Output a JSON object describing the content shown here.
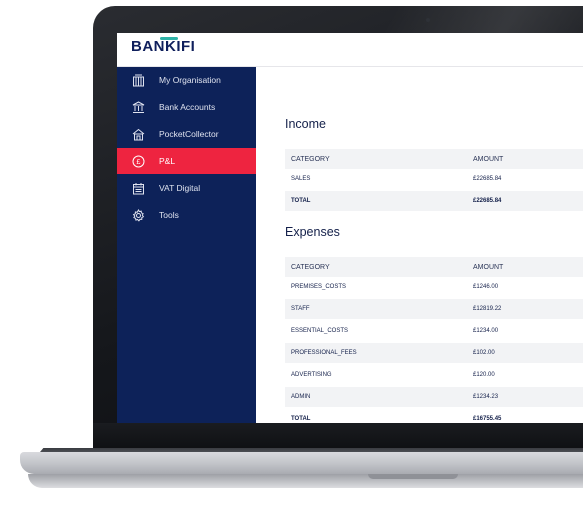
{
  "brand": {
    "name": "BANKIFI",
    "accent": "#2fb3a8",
    "navy": "#0d2259",
    "active": "#ee2440"
  },
  "sidebar": {
    "items": [
      {
        "label": "My Organisation",
        "icon": "organisation-icon",
        "active": false
      },
      {
        "label": "Bank Accounts",
        "icon": "bank-icon",
        "active": false
      },
      {
        "label": "PocketCollector",
        "icon": "home-icon",
        "active": false
      },
      {
        "label": "P&L",
        "icon": "pound-icon",
        "active": true
      },
      {
        "label": "VAT Digital",
        "icon": "calendar-icon",
        "active": false
      },
      {
        "label": "Tools",
        "icon": "gear-icon",
        "active": false
      }
    ]
  },
  "income": {
    "title": "Income",
    "headers": {
      "category": "CATEGORY",
      "amount": "AMOUNT"
    },
    "rows": [
      {
        "category": "SALES",
        "amount": "£22685.84"
      }
    ],
    "total": {
      "category": "TOTAL",
      "amount": "£22685.84"
    }
  },
  "expenses": {
    "title": "Expenses",
    "headers": {
      "category": "CATEGORY",
      "amount": "AMOUNT"
    },
    "rows": [
      {
        "category": "PREMISES_COSTS",
        "amount": "£1246.00"
      },
      {
        "category": "STAFF",
        "amount": "£12819.22"
      },
      {
        "category": "ESSENTIAL_COSTS",
        "amount": "£1234.00"
      },
      {
        "category": "PROFESSIONAL_FEES",
        "amount": "£102.00"
      },
      {
        "category": "ADVERTISING",
        "amount": "£120.00"
      },
      {
        "category": "ADMIN",
        "amount": "£1234.23"
      }
    ],
    "total": {
      "category": "TOTAL",
      "amount": "£16755.45"
    }
  }
}
